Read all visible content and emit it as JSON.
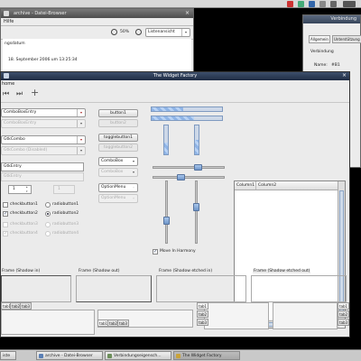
{
  "browser": {
    "title": "archive - Datei-Browser",
    "menu_help": "Hilfe",
    "zoom": "50%",
    "view": "Listenansicht",
    "field_label": "ngsdatum",
    "date_text": "18. September 2006 um 13:25:34"
  },
  "connection": {
    "title": "Verbindung",
    "tab_general": "Allgemein",
    "tab_support": "Unterstützung",
    "heading": "Verbindung",
    "name_label": "Name:",
    "name_value": "#B1"
  },
  "main": {
    "title": "The Widget Factory",
    "menu": "home",
    "combo1": "ComboBoxEntry",
    "combo2": "ComboBoxEntry",
    "combo3": "GtkCombo",
    "combo4": "GtkCombo (Disabled)",
    "entry1": "GtkEntry",
    "entry2": "GtkEntry",
    "spin1": "1",
    "spin2": "1",
    "check1": "checkbutton1",
    "check2": "checkbutton2",
    "check3": "checkbutton3",
    "check4": "checkbutton4",
    "radio1": "radiobutton1",
    "radio2": "radiobutton2",
    "radio3": "radiobutton3",
    "radio4": "radiobutton4",
    "button1": "button1",
    "button2": "button2",
    "toggle1": "togglebutton1",
    "toggle2": "togglebutton2",
    "combobox1": "ComboBox",
    "combobox2": "ComboBox",
    "option1": "OptionMenu",
    "option2": "OptionMenu",
    "move_harmony": "Move In Harmony",
    "column1": "Column1",
    "column2": "Column2",
    "frame1": "Frame (Shadow in)",
    "frame2": "Frame (Shadow out)",
    "frame3": "Frame (Shadow etched in)",
    "frame4": "Frame (Shadow etched out)",
    "tab1": "tab1",
    "tab2": "tab2",
    "tab3": "tab3"
  },
  "progress": {
    "h1": 0.45,
    "h2": 0.6,
    "v1": 0.4,
    "v2": 0.5
  },
  "taskbar": {
    "item0": "iste",
    "item1": "archive - Datei-Browser",
    "item2": "Verbindungseigensch...",
    "item3": "The Widget Factory"
  },
  "colors": {
    "accent": "#7f9ac0",
    "titlebar": "#2b3a55"
  }
}
